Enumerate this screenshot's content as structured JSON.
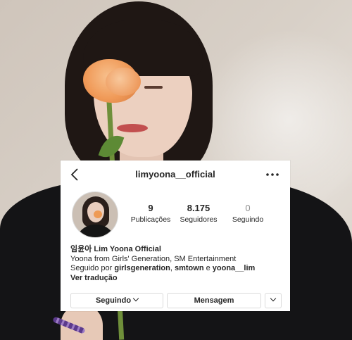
{
  "profile": {
    "username": "limyoona__official",
    "stats": [
      {
        "value": "9",
        "label": "Publicações"
      },
      {
        "value": "8.175",
        "label": "Seguidores"
      },
      {
        "value": "0",
        "label": "Seguindo"
      }
    ],
    "display_name": "임윤아 Lim Yoona Official",
    "bio_line": "Yoona from Girls' Generation, SM Entertainment",
    "followed_by_prefix": "Seguido por ",
    "followed_by_1": "girlsgeneration",
    "followed_by_sep1": ", ",
    "followed_by_2": "smtown",
    "followed_by_sep2": " e ",
    "followed_by_3": "yoona__lim",
    "see_translation": "Ver tradução"
  },
  "actions": {
    "following_label": "Seguindo",
    "message_label": "Mensagem"
  },
  "icons": {
    "back": "chevron-left-icon",
    "more": "more-horizontal-icon",
    "dropdown": "chevron-down-icon"
  },
  "colors": {
    "text": "#262626",
    "muted": "#8e8e8e",
    "border": "#dbdbdb"
  }
}
